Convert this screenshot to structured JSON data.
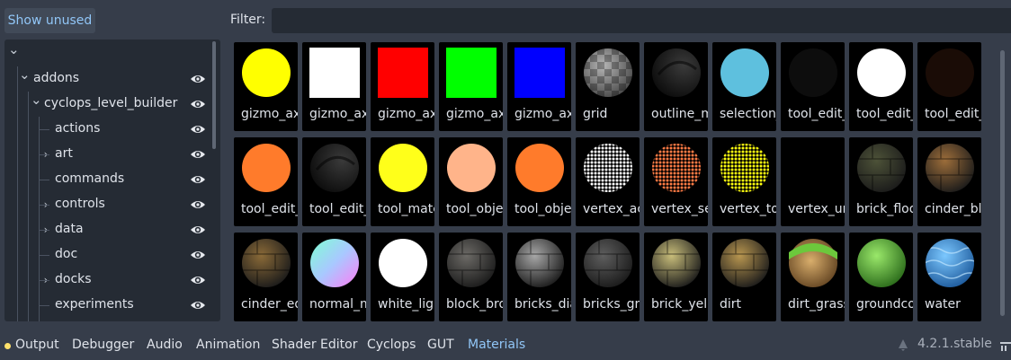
{
  "top": {
    "show_unused": "Show unused",
    "filter_label": "Filter:",
    "filter_value": ""
  },
  "tree": {
    "items": [
      {
        "label": "",
        "depth": 0,
        "chevron": "down",
        "eye": false
      },
      {
        "label": "addons",
        "depth": 1,
        "chevron": "down",
        "eye": true
      },
      {
        "label": "cyclops_level_builder",
        "depth": 2,
        "chevron": "down",
        "eye": true
      },
      {
        "label": "actions",
        "depth": 3,
        "chevron": "none",
        "eye": true
      },
      {
        "label": "art",
        "depth": 3,
        "chevron": "right",
        "eye": true
      },
      {
        "label": "commands",
        "depth": 3,
        "chevron": "none",
        "eye": true
      },
      {
        "label": "controls",
        "depth": 3,
        "chevron": "right",
        "eye": true
      },
      {
        "label": "data",
        "depth": 3,
        "chevron": "right",
        "eye": true
      },
      {
        "label": "doc",
        "depth": 3,
        "chevron": "none",
        "eye": true
      },
      {
        "label": "docks",
        "depth": 3,
        "chevron": "right",
        "eye": true
      },
      {
        "label": "experiments",
        "depth": 3,
        "chevron": "none",
        "eye": true
      }
    ]
  },
  "materials": [
    {
      "name": "gizmo_axis_x",
      "kind": "circle",
      "color": "#ffff00"
    },
    {
      "name": "gizmo_axis_x",
      "kind": "square",
      "color": "#ffffff"
    },
    {
      "name": "gizmo_axis_x",
      "kind": "square",
      "color": "#ff0000"
    },
    {
      "name": "gizmo_axis_x",
      "kind": "square",
      "color": "#00ff00"
    },
    {
      "name": "gizmo_axis_x",
      "kind": "square",
      "color": "#0000ff"
    },
    {
      "name": "grid",
      "kind": "checker",
      "color": "#7a7a7a"
    },
    {
      "name": "outline_mat",
      "kind": "dark-sphere",
      "color": "#1b1b1b"
    },
    {
      "name": "selection_mat",
      "kind": "circle",
      "color": "#5ec0de"
    },
    {
      "name": "tool_edit_mat",
      "kind": "circle",
      "color": "#0d0d0d"
    },
    {
      "name": "tool_edit_mat",
      "kind": "circle",
      "color": "#ffffff"
    },
    {
      "name": "tool_edit_mat",
      "kind": "circle",
      "color": "#1a0c06"
    },
    {
      "name": "tool_edit_mat",
      "kind": "circle",
      "color": "#ff7b2b"
    },
    {
      "name": "tool_edit_mat",
      "kind": "dark-sphere",
      "color": "#1e1e1e"
    },
    {
      "name": "tool_material",
      "kind": "circle",
      "color": "#ffff1a"
    },
    {
      "name": "tool_object",
      "kind": "circle",
      "color": "#ffb48a"
    },
    {
      "name": "tool_object",
      "kind": "circle",
      "color": "#ff7b2b"
    },
    {
      "name": "vertex_active",
      "kind": "dots",
      "color": "#ffffff"
    },
    {
      "name": "vertex_selected",
      "kind": "dots",
      "color": "#ff7b45"
    },
    {
      "name": "vertex_tool",
      "kind": "dots",
      "color": "#ffff10"
    },
    {
      "name": "vertex_unselected",
      "kind": "none",
      "color": "#000000"
    },
    {
      "name": "brick_floor",
      "kind": "stone",
      "color": "#4d5238"
    },
    {
      "name": "cinder_block",
      "kind": "stone",
      "color": "#9c6d3a"
    },
    {
      "name": "cinder_edge",
      "kind": "stone",
      "color": "#8a6a38"
    },
    {
      "name": "normal_mat",
      "kind": "rainbow",
      "color": "#9ae3ff"
    },
    {
      "name": "white_light",
      "kind": "circle",
      "color": "#ffffff"
    },
    {
      "name": "block_brown",
      "kind": "stone",
      "color": "#6c6a66"
    },
    {
      "name": "bricks_diag",
      "kind": "stone",
      "color": "#a7a7a7"
    },
    {
      "name": "bricks_grey",
      "kind": "stone",
      "color": "#5e5e5e"
    },
    {
      "name": "brick_yellow",
      "kind": "stone",
      "color": "#c8bd7a"
    },
    {
      "name": "dirt",
      "kind": "stone",
      "color": "#b89650"
    },
    {
      "name": "dirt_grass",
      "kind": "grass",
      "color": "#b38a52"
    },
    {
      "name": "groundcover",
      "kind": "grass-ball",
      "color": "#5fc23a"
    },
    {
      "name": "water",
      "kind": "water",
      "color": "#3d9ad8"
    }
  ],
  "bottom": {
    "tabs": [
      "Output",
      "Debugger",
      "Audio",
      "Animation",
      "Shader Editor",
      "Cyclops",
      "GUT",
      "Materials"
    ],
    "active_tab": "Materials",
    "version": "4.2.1.stable"
  }
}
